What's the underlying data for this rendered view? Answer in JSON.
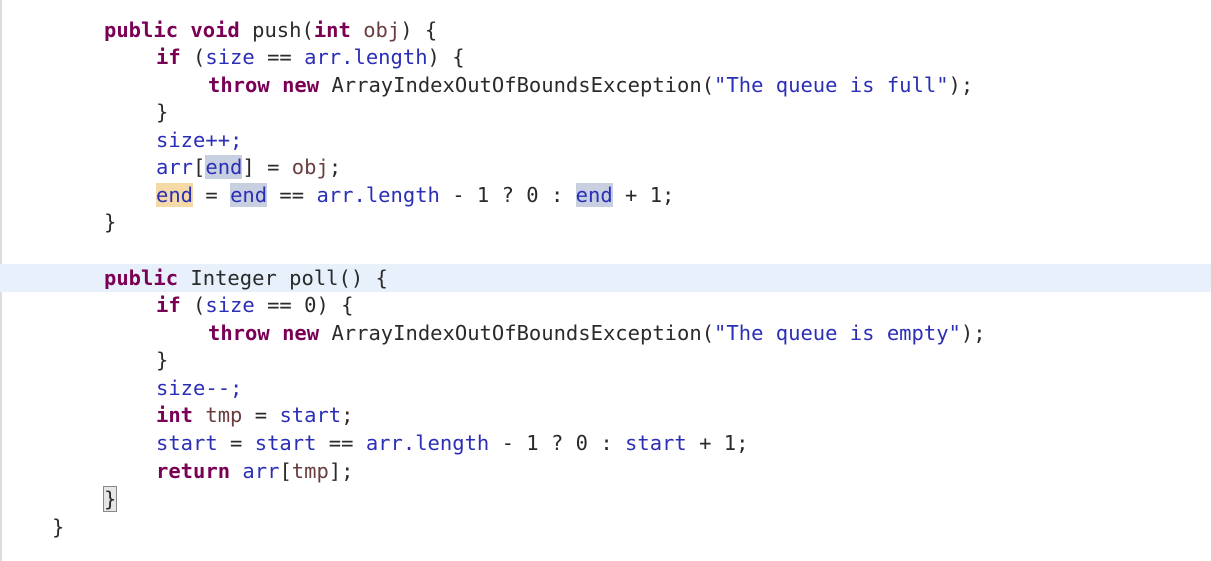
{
  "code": {
    "push": {
      "kw_public": "public",
      "kw_void": "void",
      "name": "push(",
      "kw_int": "int",
      "param": "obj",
      "sig_end": ") {",
      "if_kw": "if",
      "if_open": "(",
      "size": "size",
      "eqeq": "==",
      "arr_len": "arr.length",
      "if_close": ") {",
      "throw_kw": "throw",
      "new_kw": "new",
      "exc_call": "ArrayIndexOutOfBoundsException(",
      "msg": "\"The queue is full\"",
      "exc_end": ");",
      "close_if": "}",
      "size_inc": "size++;",
      "arr": "arr",
      "lb": "[",
      "end": "end",
      "rb_assign": "] = ",
      "obj": "obj",
      "semi": ";",
      "end_lhs": "end",
      "assign": " = ",
      "end_rhs1": "end",
      "cmp": " == ",
      "arr_len2": "arr.length",
      "tern": " - 1 ? 0 : ",
      "end_rhs2": "end",
      "plus": " + 1;",
      "close_method": "}"
    },
    "poll": {
      "kw_public": "public",
      "type": "Integer",
      "name": "poll() {",
      "if_kw": "if",
      "if_open": "(",
      "size": "size",
      "cond_rest": " == 0) {",
      "throw_kw": "throw",
      "new_kw": "new",
      "exc_call": "ArrayIndexOutOfBoundsException(",
      "msg": "\"The queue is empty\"",
      "exc_end": ");",
      "close_if": "}",
      "size_dec": "size--;",
      "int_kw": "int",
      "tmp": "tmp",
      "assign_start": " = ",
      "start": "start",
      "semi": ";",
      "start_lhs": "start",
      "assign": " = ",
      "start_rhs1": "start",
      "cmp": " == ",
      "arr_len": "arr.length",
      "tern": " - 1 ? 0 : ",
      "start_rhs2": "start",
      "plus": " + 1;",
      "return_kw": "return",
      "arr": "arr",
      "lb": "[",
      "tmp2": "tmp",
      "rb": "];",
      "close_method": "}"
    },
    "close_class": "}"
  },
  "colors": {
    "keyword": "#7a0055",
    "field": "#2b2fb6",
    "string": "#2b2fb6",
    "local_var": "#6a3e3e",
    "current_line": "#e8f0fb",
    "occurrence": "#c8cfe0",
    "write_occurrence": "#f5d9a6"
  }
}
